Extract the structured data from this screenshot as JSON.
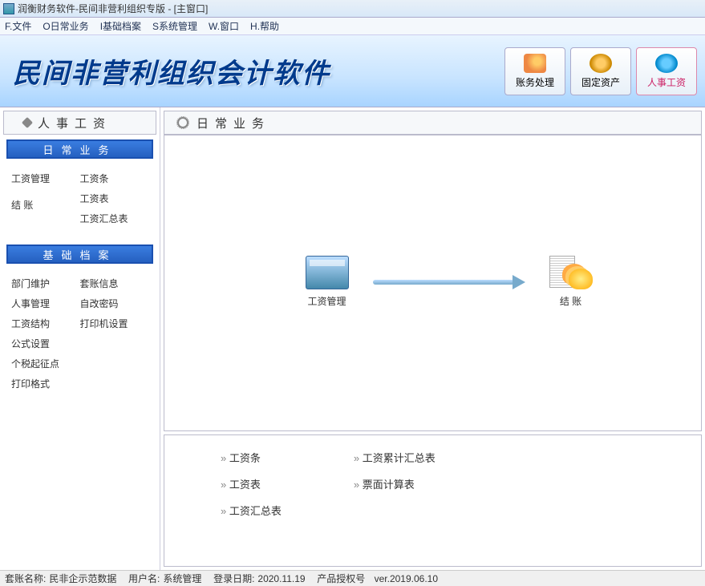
{
  "window": {
    "title": "润衡财务软件-民间非营利组织专版 - [主窗口]"
  },
  "menu": [
    "F.文件",
    "O日常业务",
    "I基础档案",
    "S系统管理",
    "W.窗口",
    "H.帮助"
  ],
  "banner": {
    "logo": "民间非营利组织会计软件",
    "buttons": [
      {
        "label": "账务处理",
        "icon": "docs",
        "active": false
      },
      {
        "label": "固定资产",
        "icon": "asset",
        "active": false
      },
      {
        "label": "人事工资",
        "icon": "people",
        "active": true
      }
    ]
  },
  "sidebar": {
    "title": "人事工资",
    "group1": {
      "header": "日常业务",
      "colA": [
        "工资管理",
        "",
        "结 账"
      ],
      "colB": [
        "工资条",
        "工资表",
        "工资汇总表"
      ]
    },
    "group2": {
      "header": "基础档案",
      "colA": [
        "部门维护",
        "人事管理",
        "工资结构",
        "公式设置",
        "个税起征点",
        "打印格式"
      ],
      "colB": [
        "套账信息",
        "自改密码",
        "打印机设置"
      ]
    }
  },
  "main": {
    "title": "日常业务",
    "flow": {
      "start": "工资管理",
      "end": "结 账"
    },
    "links": {
      "col1": [
        "工资条",
        "工资表",
        "工资汇总表"
      ],
      "col2": [
        "工资累计汇总表",
        "票面计算表"
      ]
    }
  },
  "status": {
    "acct_label": "套账名称:",
    "acct": "民非企示范数据",
    "user_label": "用户名:",
    "user": "系统管理",
    "date_label": "登录日期:",
    "date": "2020.11.19",
    "lic_label": "产品授权号",
    "lic": "ver.2019.06.10"
  }
}
